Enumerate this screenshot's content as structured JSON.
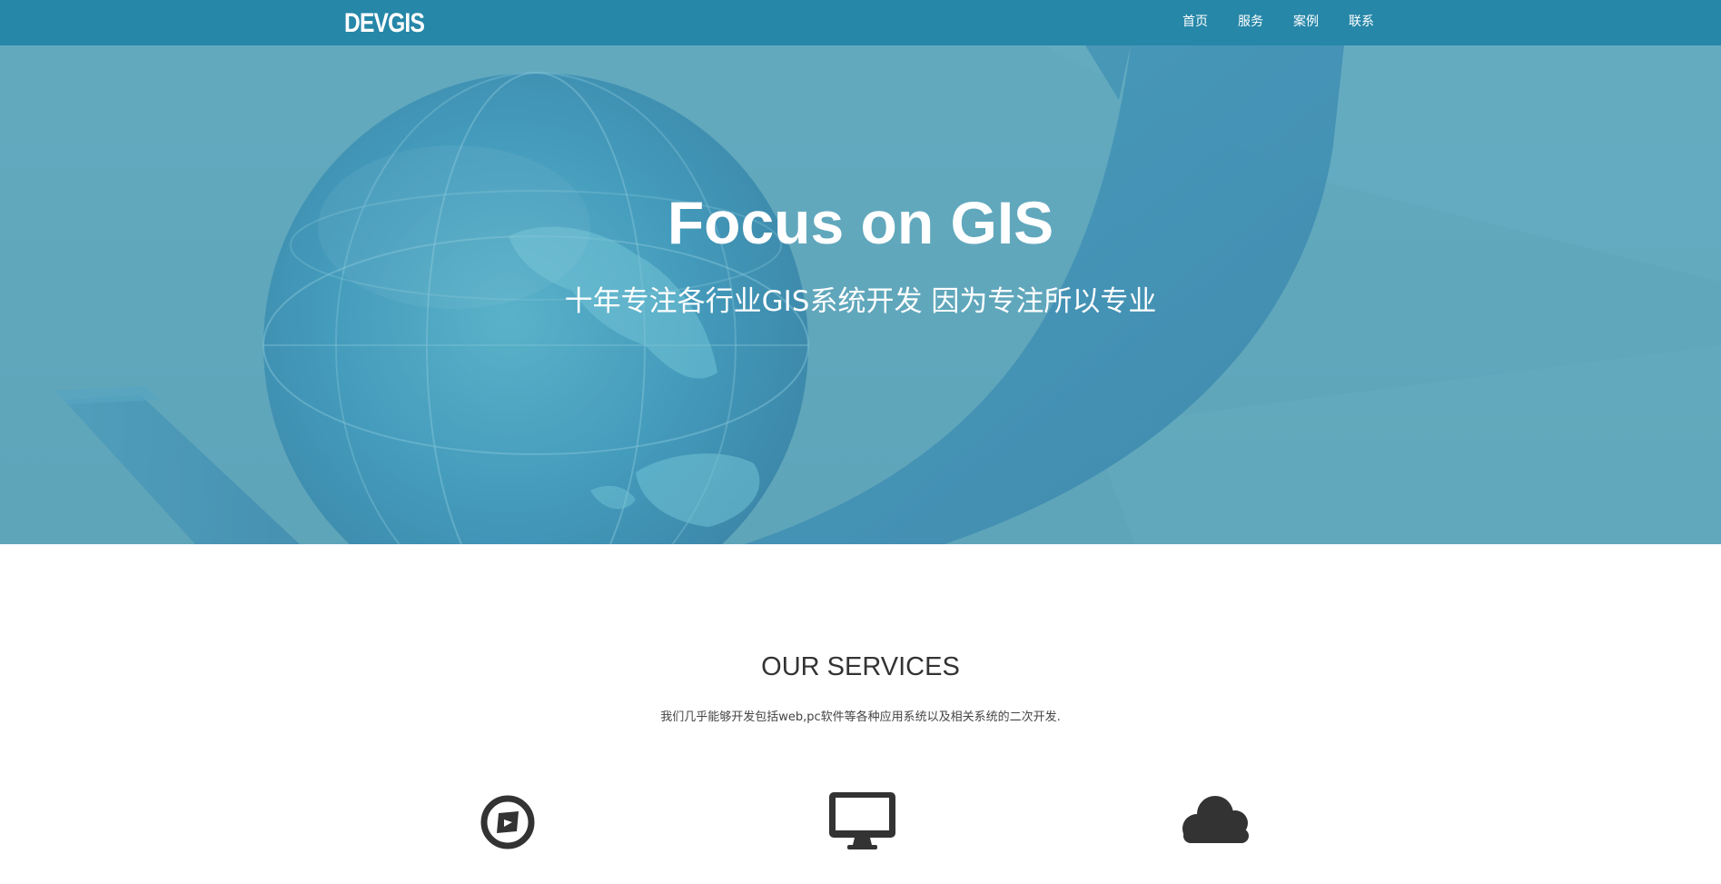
{
  "navbar": {
    "brand": "DEVGIS",
    "links": [
      "首页",
      "服务",
      "案例",
      "联系"
    ]
  },
  "hero": {
    "title": "Focus on GIS",
    "subtitle": "十年专注各行业GIS系统开发 因为专注所以专业"
  },
  "services": {
    "title": "OUR SERVICES",
    "description": "我们几乎能够开发包括web,pc软件等各种应用系统以及相关系统的二次开发.",
    "items": [
      {
        "icon": "compass-icon"
      },
      {
        "icon": "desktop-icon"
      },
      {
        "icon": "cloud-icon"
      }
    ]
  },
  "colors": {
    "navbar": "#2687a8",
    "hero": "#5ba3b8",
    "icon": "#333333"
  }
}
